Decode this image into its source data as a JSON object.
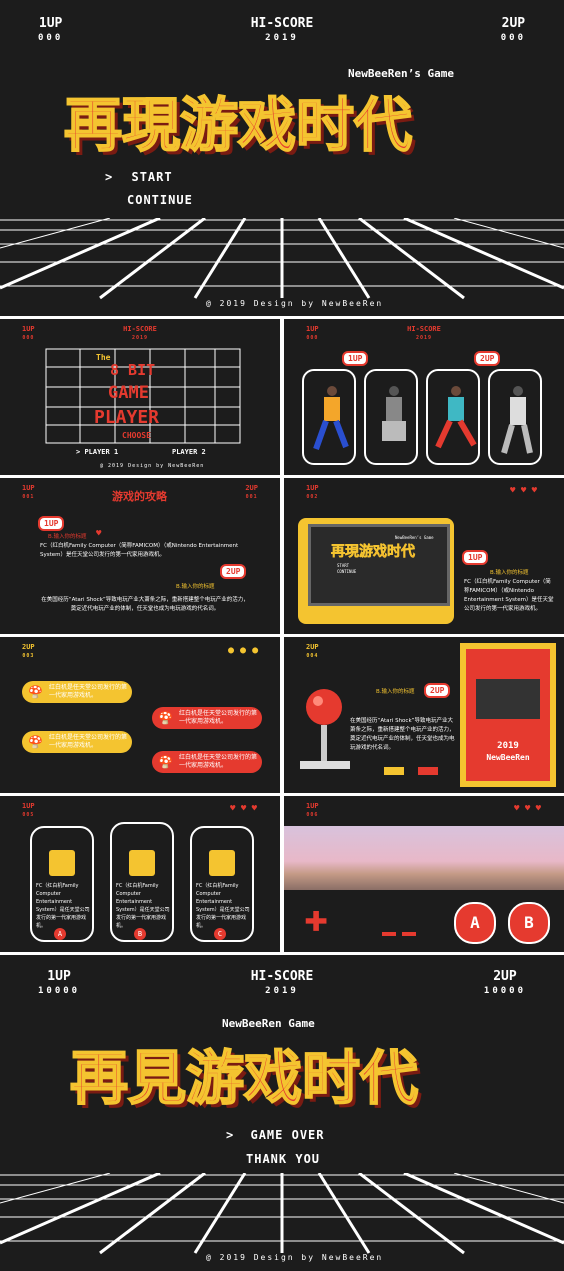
{
  "colors": {
    "red": "#e53a2f",
    "yellow": "#f4c430",
    "bg": "#1c1c1c"
  },
  "cover": {
    "p1_label": "1UP",
    "p1_score": "000",
    "hiscore_label": "HI-SCORE",
    "hiscore_value": "2019",
    "p2_label": "2UP",
    "p2_score": "000",
    "brand": "NewBeeRen’s Game",
    "title": "再現游戏时代",
    "menu_start": "START",
    "menu_continue": "CONTINUE",
    "cursor": ">",
    "footer": "@ 2019 Design by NewBeeRen"
  },
  "slide2": {
    "p1": "1UP",
    "p1_score": "000",
    "hi": "HI-SCORE",
    "hi_val": "2019",
    "the": "The",
    "line1": "8 BIT",
    "line2": "GAME",
    "line3": "PLAYER",
    "choose": "CHOOSE",
    "player1": "PLAYER 1",
    "player2": "PLAYER 2",
    "cursor": ">",
    "footer": "@ 2019 Design by NewBeeRen"
  },
  "slide3": {
    "p1": "1UP",
    "p1_score": "000",
    "hi": "HI-SCORE",
    "hi_val": "2019",
    "bubble1": "1UP",
    "bubble2": "2UP"
  },
  "slide4": {
    "p1": "1UP",
    "p1_score": "001",
    "p2": "2UP",
    "p2_score": "001",
    "heading": "游戏的攻略",
    "b1": "1UP",
    "b1_caption": "B.输入你的标题",
    "b1_text": "FC（红白机Family Computer（简称FAMICOM）（或Nintendo Entertainment System）是任天堂公司发行的第一代家用游戏机。",
    "b2": "2UP",
    "b2_caption": "B.输入你的标题",
    "b2_text": "在美国经历“Atari Shock”导致电玩产业大萧条之际，重新搭建整个电玩产业的活力，奠定近代电玩产业的体制，任天堂也成为电玩游戏的代名词。"
  },
  "slide5": {
    "p1": "1UP",
    "p1_score": "002",
    "screen_title": "再現游戏时代",
    "screen_brand": "NewBeeRen’s Game",
    "screen_start": "START",
    "screen_continue": "CONTINUE",
    "bubble": "1UP",
    "caption": "B.输入你的标题",
    "text": "FC（红白机Family Computer（简称FAMICOM）（或Nintendo Entertainment System）是任天堂公司发行的第一代家用游戏机。"
  },
  "slide6": {
    "p": "2UP",
    "p_score": "003",
    "pill_text": "红白机是任天堂公司发行的第一代家用游戏机。"
  },
  "slide7": {
    "p": "2UP",
    "p_score": "004",
    "caption": "B.输入你的标题",
    "bubble": "2UP",
    "text": "在美国经历“Atari Shock”导致电玩产业大萧条之际，重新搭建整个电玩产业的活力，奠定近代电玩产业的体制，任天堂也成为电玩游戏的代名词。",
    "arcade_year": "2019",
    "arcade_brand": "NewBeeRen"
  },
  "slide8": {
    "p": "1UP",
    "p_score": "005",
    "card_text": "FC（红白机Family Computer Entertainment System）是任天堂公司发行的第一代家用游戏机。",
    "labels": [
      "A",
      "B",
      "C"
    ]
  },
  "slide9": {
    "p": "1UP",
    "p_score": "006",
    "btn_a": "A",
    "btn_b": "B"
  },
  "ending": {
    "p1_label": "1UP",
    "p1_score": "10000",
    "hiscore_label": "HI-SCORE",
    "hiscore_value": "2019",
    "p2_label": "2UP",
    "p2_score": "10000",
    "brand": "NewBeeRen Game",
    "title": "再見游戏时代",
    "menu_over": "GAME OVER",
    "menu_thanks": "THANK YOU",
    "cursor": ">",
    "footer": "@ 2019 Design by NewBeeRen"
  }
}
